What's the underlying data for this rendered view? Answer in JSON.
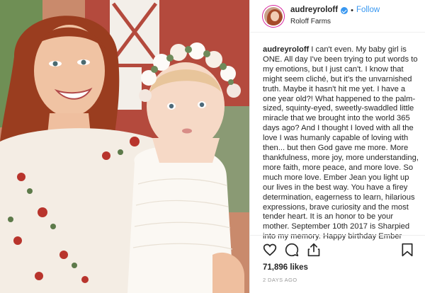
{
  "post": {
    "username": "audreyroloff",
    "dot": "•",
    "follow_label": "Follow",
    "location": "Roloff Farms",
    "caption_user": "audreyroloff",
    "caption_text": "I can't even. My baby girl is ONE. All day I've been trying to put words to my emotions, but I just can't. I know that might seem cliché, but it's the unvarnished truth. Maybe it hasn't hit me yet. I have a one year old?! What happened to the palm-sized, squinty-eyed, sweetly-swaddled little miracle that we brought into the world 365 days ago? And I thought I loved with all the love I was humanly capable of loving with then... but then God gave me more. More thankfulness, more joy, more understanding, more faith, more peace, and more love. So much more love. Ember Jean you light up our lives in the best way. You have a firey determination, eagerness to learn, hilarious expressions, brave curiosity and the most tender heart. It is an honor to be your mother. September 10th 2017 is Sharpied into my memory. Happy birthday Ember",
    "likes": "71,896 likes",
    "time_ago": "2 DAYS AGO"
  },
  "icons": [
    "heart-icon",
    "comment-icon",
    "share-icon",
    "bookmark-icon",
    "verified-badge-icon"
  ],
  "colors": {
    "link_blue": "#3897f0",
    "text": "#262626",
    "muted": "#999999",
    "divider": "#efefef"
  }
}
